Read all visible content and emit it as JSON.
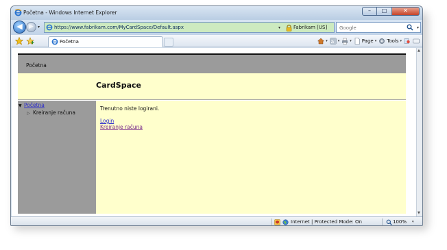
{
  "window": {
    "title": "Početna - Windows Internet Explorer",
    "minimize_glyph": "–",
    "maximize_glyph": "□",
    "close_glyph": "✕"
  },
  "address_bar": {
    "url": "https://www.fabrikam.com/MyCardSpace/Default.aspx",
    "certificate": "Fabrikam [US]",
    "refresh_glyph": "↻",
    "stop_glyph": "✕",
    "back_glyph": "◀",
    "forward_glyph": "▶",
    "dropdown_glyph": "▾"
  },
  "search": {
    "placeholder": "Google",
    "dropdown_glyph": "▾"
  },
  "tab": {
    "label": "Početna"
  },
  "commands": {
    "page_label": "Page",
    "tools_label": "Tools",
    "dropdown_glyph": "▾"
  },
  "page": {
    "breadcrumb": "Početna",
    "banner_title": "CardSpace",
    "tree": {
      "root_label": "Početna",
      "expanded_glyph": "▼",
      "collapsed_glyph": "▷",
      "child_label": "Kreiranje računa"
    },
    "main": {
      "status_message": "Trenutno niste logirani.",
      "login_link": "Login",
      "register_link": "Kreiranje računa"
    }
  },
  "status_bar": {
    "zone": "Internet | Protected Mode: On",
    "zoom": "100%",
    "dropdown_glyph": "▾"
  },
  "scrollbar": {
    "up_glyph": "▲",
    "down_glyph": "▼"
  },
  "colors": {
    "page_band": "#9b9b9b",
    "page_banner": "#ffffcc",
    "link": "#2c2ccc",
    "visited_link": "#7a2c8c",
    "address_secure": "#cdeac0"
  },
  "icons": {
    "title": "ie-logo-icon",
    "page": "page-icon",
    "lock": "lock-icon",
    "search": "search-icon",
    "favorites": "star-icon",
    "add_favorites": "add-favorites-icon",
    "home": "home-icon",
    "feeds": "feeds-icon",
    "print": "print-icon",
    "page_menu": "page-menu-icon",
    "tools_menu": "gear-icon",
    "research": "research-icon",
    "messenger": "messenger-icon",
    "protected_mode": "shield-icon",
    "internet_zone": "globe-icon",
    "zoom": "zoom-icon"
  }
}
